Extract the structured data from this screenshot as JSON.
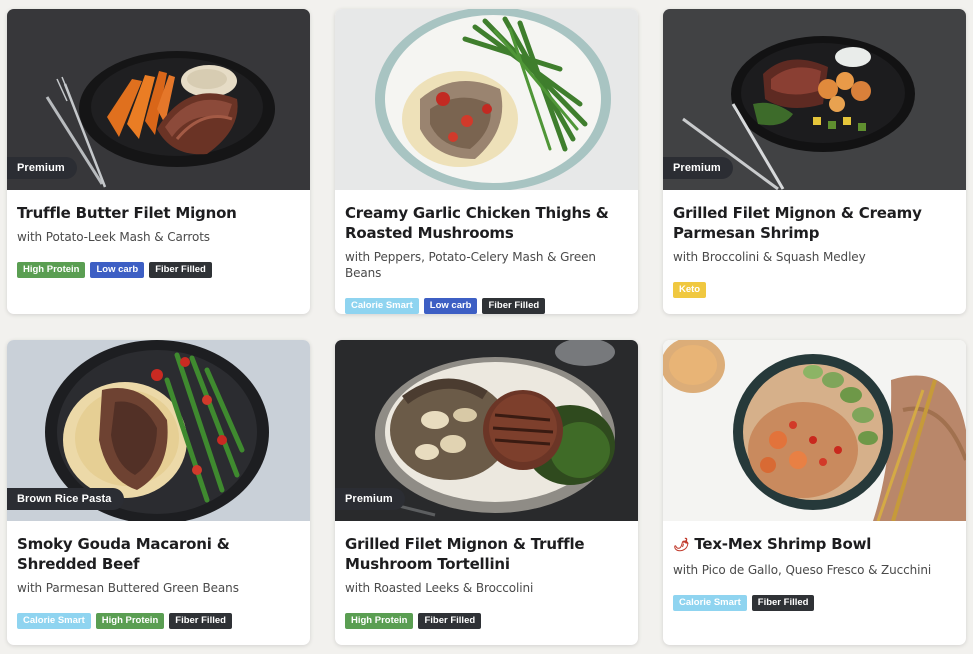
{
  "colors": {
    "page_background": "#f2f1ee",
    "ribbon": "#2b2d33",
    "tag_high_protein": "#5a9e52",
    "tag_low_carb": "#3d5fc4",
    "tag_fiber_filled": "#2f3236",
    "tag_calorie_smart": "#8fd4f0",
    "tag_keto": "#f0c840"
  },
  "meals": [
    {
      "badge": "Premium",
      "title": "Truffle Butter Filet Mignon",
      "subtitle": "with Potato-Leek Mash & Carrots",
      "tags": [
        "High Protein",
        "Low carb",
        "Fiber Filled"
      ]
    },
    {
      "badge": "",
      "title": "Creamy Garlic Chicken Thighs & Roasted Mushrooms",
      "subtitle": "with Peppers, Potato-Celery Mash & Green Beans",
      "tags": [
        "Calorie Smart",
        "Low carb",
        "Fiber Filled"
      ]
    },
    {
      "badge": "Premium",
      "title": "Grilled Filet Mignon & Creamy Parmesan Shrimp",
      "subtitle": "with Broccolini & Squash Medley",
      "tags": [
        "Keto"
      ]
    },
    {
      "badge": "Brown Rice Pasta",
      "title": "Smoky Gouda Macaroni & Shredded Beef",
      "subtitle": "with Parmesan Buttered Green Beans",
      "tags": [
        "Calorie Smart",
        "High Protein",
        "Fiber Filled"
      ]
    },
    {
      "badge": "Premium",
      "title": "Grilled Filet Mignon & Truffle Mushroom Tortellini",
      "subtitle": "with Roasted Leeks & Broccolini",
      "tags": [
        "High Protein",
        "Fiber Filled"
      ]
    },
    {
      "badge": "",
      "spicy_icon": "chili-pepper-icon",
      "title": "Tex-Mex Shrimp Bowl",
      "subtitle": "with Pico de Gallo, Queso Fresco & Zucchini",
      "tags": [
        "Calorie Smart",
        "Fiber Filled"
      ]
    }
  ]
}
